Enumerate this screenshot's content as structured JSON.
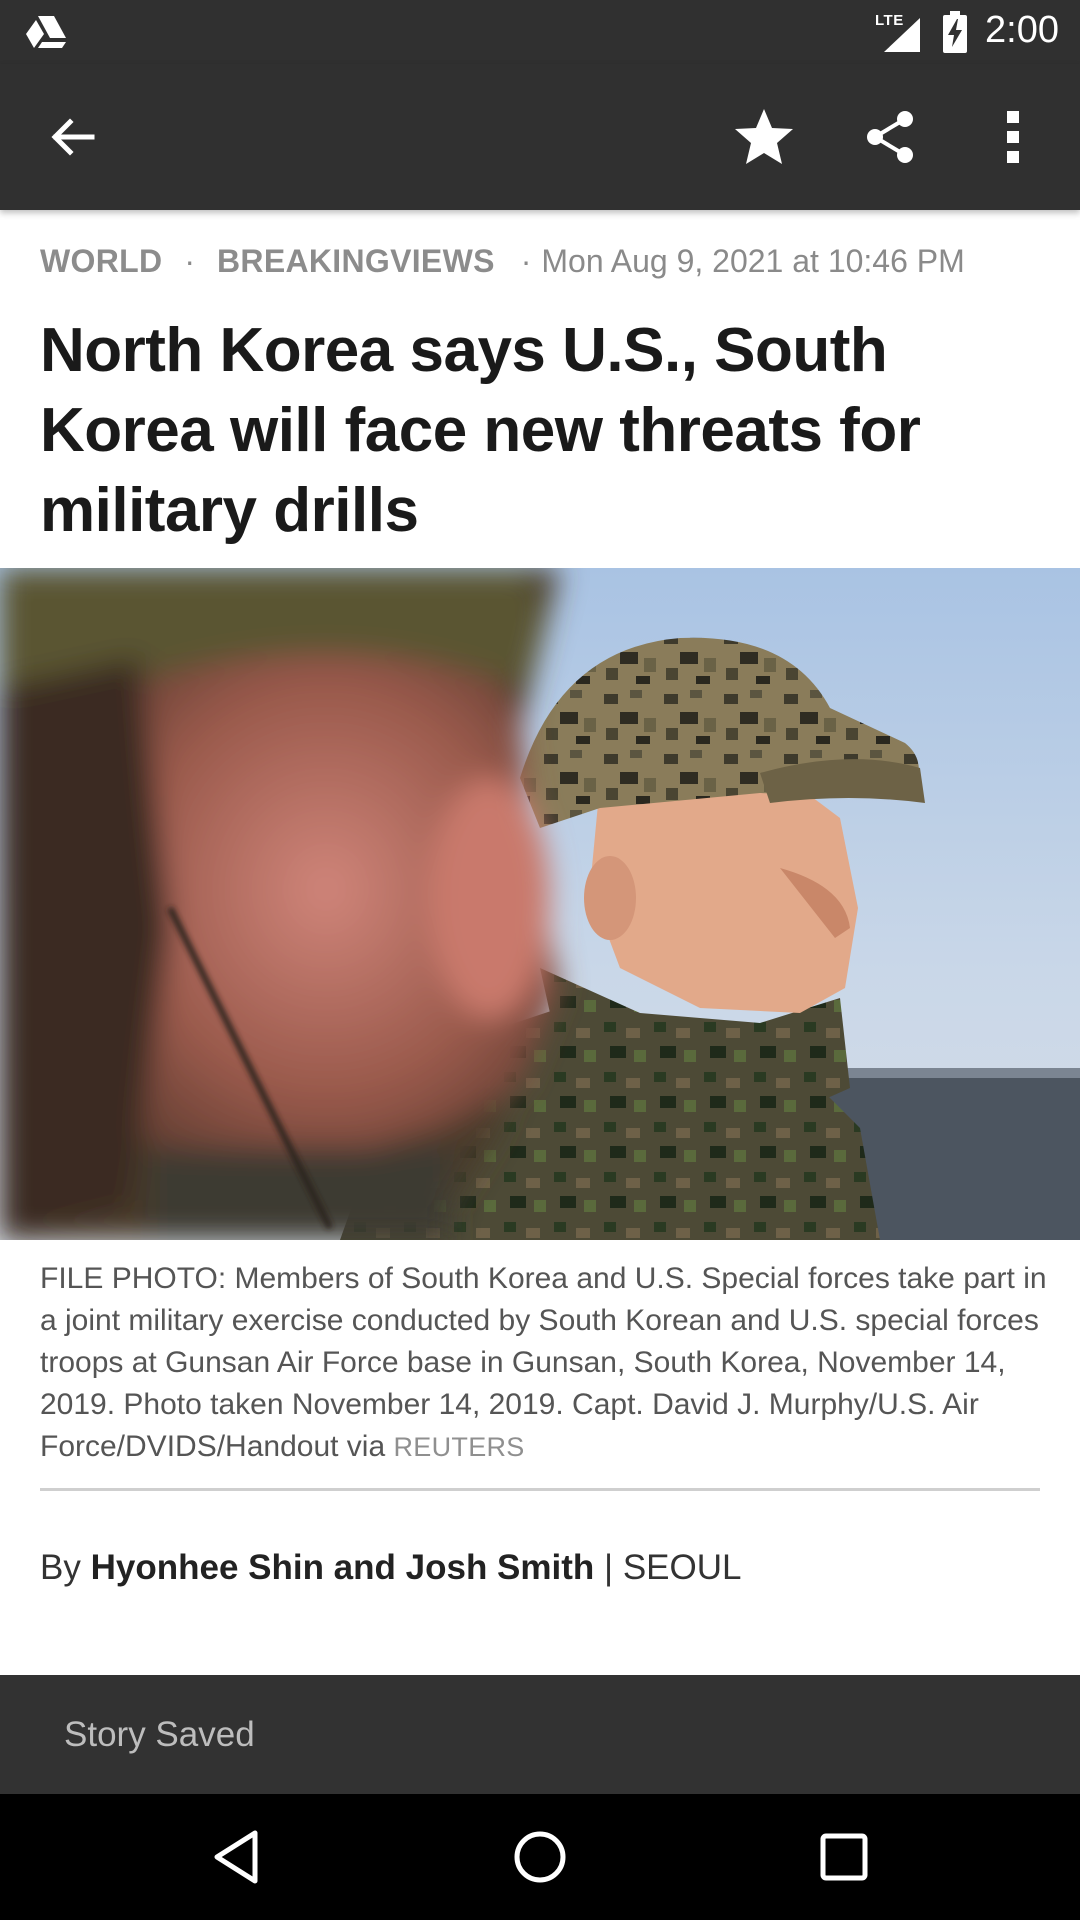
{
  "status_bar": {
    "network_label": "LTE",
    "time": "2:00",
    "icons": [
      "drive-icon",
      "signal-icon",
      "battery-charging-icon"
    ]
  },
  "toolbar": {
    "back_icon": "arrow-back-icon",
    "actions": [
      "star-icon",
      "share-icon",
      "more-vert-icon"
    ]
  },
  "article": {
    "category_primary": "WORLD",
    "separator": "·",
    "category_secondary": "BREAKINGVIEWS",
    "timestamp": "Mon Aug 9, 2021 at 10:46 PM",
    "headline": "North Korea says U.S., South Korea will face new threats for military drills",
    "caption_text": "FILE PHOTO: Members of South Korea and U.S. Special forces take part in a joint military exercise conducted by South Korean and U.S. special forces troops at Gunsan Air Force base in Gunsan, South Korea, November 14, 2019.  Photo taken November 14, 2019.  Capt. David J. Murphy/U.S. Air Force/DVIDS/Handout via",
    "caption_credit": "REUTERS",
    "byline_prefix": "By",
    "byline_authors": "Hyonhee Shin and Josh Smith",
    "byline_separator": "|",
    "byline_location": "SEOUL"
  },
  "snackbar": {
    "message": "Story Saved"
  },
  "navbar": {
    "buttons": [
      "nav-back-icon",
      "nav-home-icon",
      "nav-recents-icon"
    ]
  },
  "colors": {
    "toolbar_bg": "#303030",
    "snackbar_bg": "#323232",
    "navbar_bg": "#000000",
    "headline": "#1a1a1a",
    "meta_text": "#8a8a8a"
  }
}
